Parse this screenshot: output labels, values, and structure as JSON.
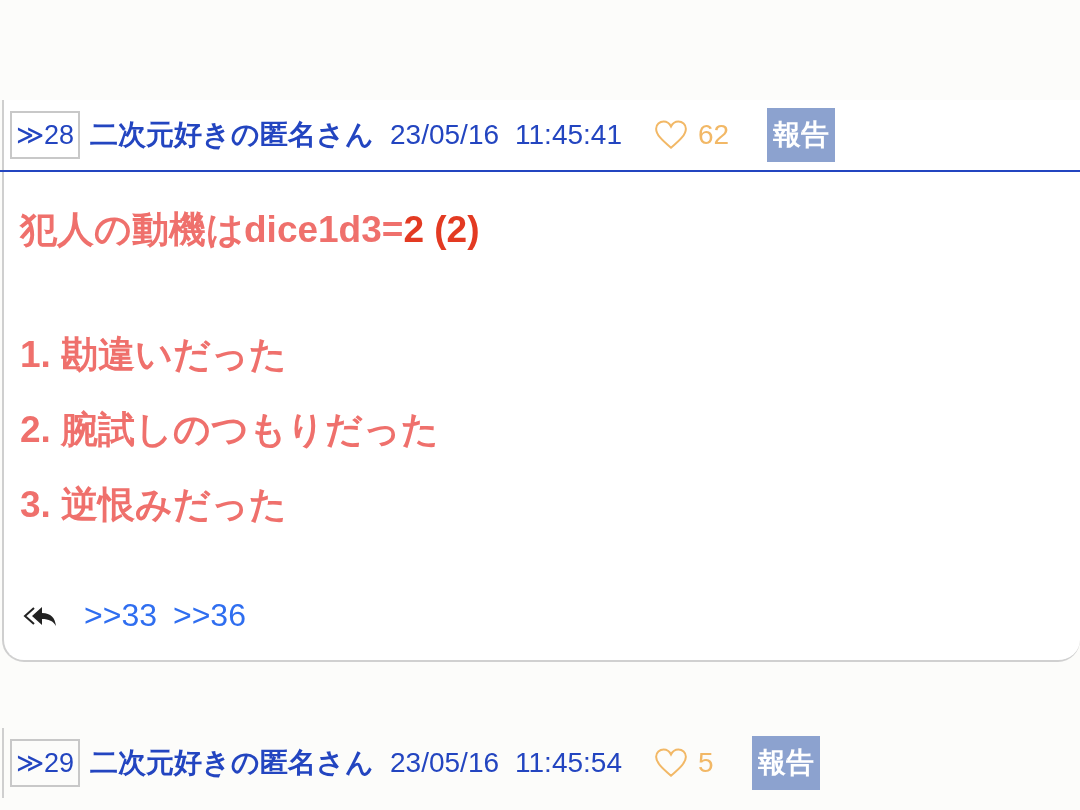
{
  "posts": [
    {
      "number": "≫28",
      "author": "二次元好きの匿名さん",
      "date": "23/05/16",
      "time": "11:45:41",
      "likes": "62",
      "report": "報告",
      "body": [
        {
          "kind": "text",
          "segments": [
            {
              "text": "犯人の動機はdice1d3=",
              "kind": "plain"
            },
            {
              "text": "2 (2)",
              "kind": "result"
            }
          ]
        },
        {
          "kind": "blank"
        },
        {
          "kind": "text",
          "segments": [
            {
              "text": "1. 勘違いだった",
              "kind": "plain"
            }
          ]
        },
        {
          "kind": "text",
          "segments": [
            {
              "text": "2. 腕試しのつもりだった",
              "kind": "plain"
            }
          ]
        },
        {
          "kind": "text",
          "segments": [
            {
              "text": "3. 逆恨みだった",
              "kind": "plain"
            }
          ]
        }
      ],
      "replies": [
        ">>33",
        ">>36"
      ]
    },
    {
      "number": "≫29",
      "author": "二次元好きの匿名さん",
      "date": "23/05/16",
      "time": "11:45:54",
      "likes": "5",
      "report": "報告"
    }
  ]
}
